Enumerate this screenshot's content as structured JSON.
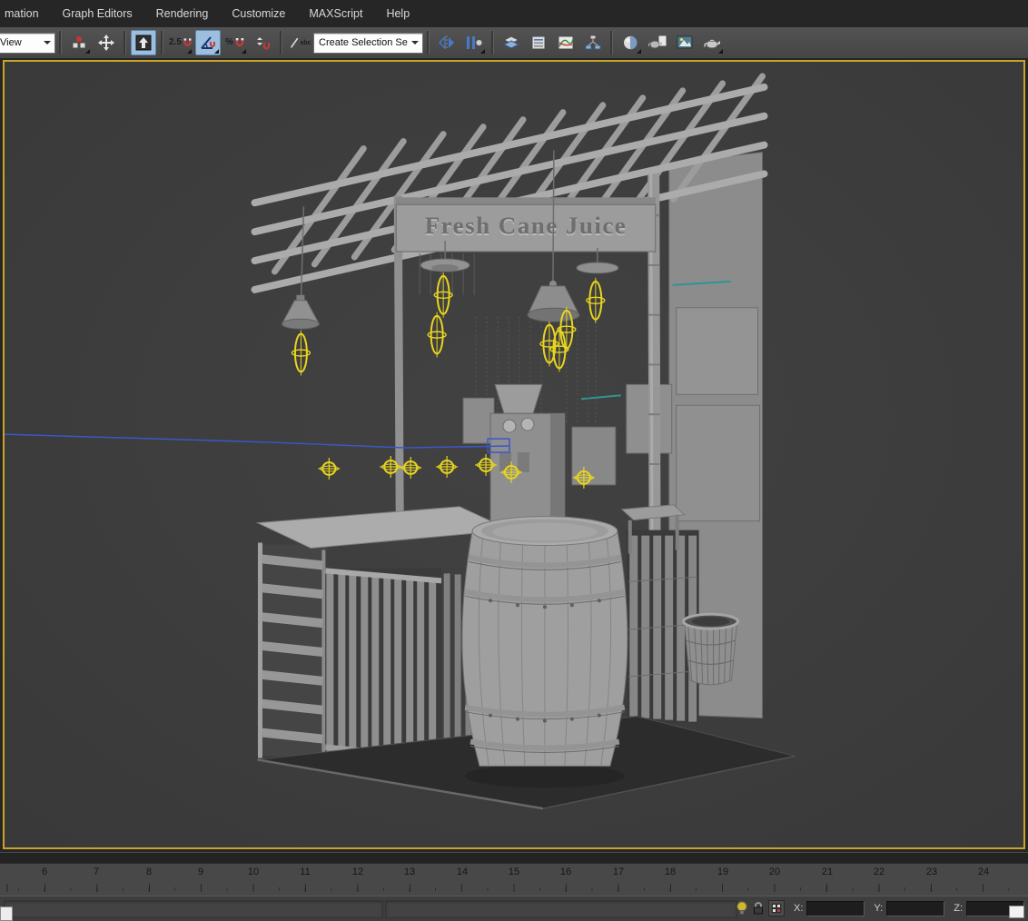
{
  "app": {
    "name": "3ds Max scene viewport"
  },
  "colors": {
    "active_viewport_border": "#c9a42b",
    "light_gizmo": "#e8d51f",
    "selected_spline": "#3a57c8",
    "teal_spline": "#2f9494"
  },
  "menu_bar": {
    "items": [
      "mation",
      "Graph Editors",
      "Rendering",
      "Customize",
      "MAXScript",
      "Help"
    ]
  },
  "toolbar": {
    "reference_coordinate_value": "View",
    "snap_toggle_label": "2.5",
    "percent_snap_label": "%",
    "selection_sets_icon_label": "abc",
    "named_selection_set_value": "Create Selection Se",
    "icons": [
      "use-center",
      "select-and-manipulate",
      "keyboard-override",
      "snaps-toggle-2.5",
      "angle-snap",
      "percent-snap",
      "spinner-snap",
      "edit-named-selection-sets",
      "mirror",
      "align",
      "layer-manager",
      "scene-explorer",
      "curve-editor",
      "schematic-view",
      "material-editor",
      "render-setup",
      "rendered-frame-window",
      "render-production"
    ]
  },
  "viewport": {
    "sign_text": "Fresh Cane Juice"
  },
  "timeline": {
    "frames": [
      "6",
      "7",
      "8",
      "9",
      "10",
      "11",
      "12",
      "13",
      "14",
      "15",
      "16",
      "17",
      "18",
      "19",
      "20",
      "21",
      "22",
      "23",
      "24"
    ]
  },
  "status_bar": {
    "x_label": "X:",
    "y_label": "Y:",
    "z_label": "Z:",
    "x_value": "",
    "y_value": "",
    "z_value": ""
  }
}
